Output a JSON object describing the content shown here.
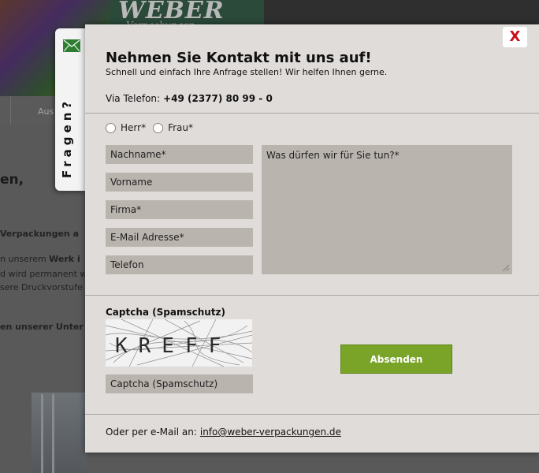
{
  "background": {
    "logo": "WEBER",
    "logo_sub": "Verpackungen",
    "nav_item": "Aus",
    "heading_fragment": "en,",
    "text_lines": [
      {
        "pre": "",
        "bold": "Verpackungen a",
        "post": ""
      },
      {
        "pre": "n unserem ",
        "bold": "Werk i",
        "post": ""
      },
      {
        "pre": "d wird permanent w",
        "bold": "",
        "post": ""
      },
      {
        "pre": "sere Druckvorstufe",
        "bold": "",
        "post": ""
      },
      {
        "pre": "",
        "bold": "en unserer Unter",
        "post": ""
      }
    ]
  },
  "side_tab": {
    "icon": "mail-icon",
    "label": "Fragen?"
  },
  "modal": {
    "close_label": "X",
    "title": "Nehmen Sie Kontakt mit uns auf!",
    "subtitle": "Schnell und einfach Ihre Anfrage stellen! Wir helfen Ihnen gerne.",
    "phone_label": "Via Telefon:",
    "phone_number": "+49 (2377) 80 99 - 0",
    "salutation": [
      {
        "label": "Herr*",
        "checked": false
      },
      {
        "label": "Frau*",
        "checked": false
      }
    ],
    "fields": [
      {
        "placeholder": "Nachname*"
      },
      {
        "placeholder": "Vorname"
      },
      {
        "placeholder": "Firma*"
      },
      {
        "placeholder": "E-Mail Adresse*"
      },
      {
        "placeholder": "Telefon"
      }
    ],
    "message_placeholder": "Was dürfen wir für Sie tun?*",
    "captcha_label": "Captcha (Spamschutz)",
    "captcha_text": "KREFF",
    "captcha_field_placeholder": "Captcha (Spamschutz)",
    "submit_label": "Absenden",
    "footer_text": "Oder per e-Mail an:",
    "footer_email": "info@weber-verpackungen.de"
  },
  "colors": {
    "modal_bg": "#e0dcda",
    "field_bg": "#bab4ae",
    "submit_bg": "#7aa428",
    "close_x": "#c8101a",
    "mail_icon": "#2e7d32"
  }
}
